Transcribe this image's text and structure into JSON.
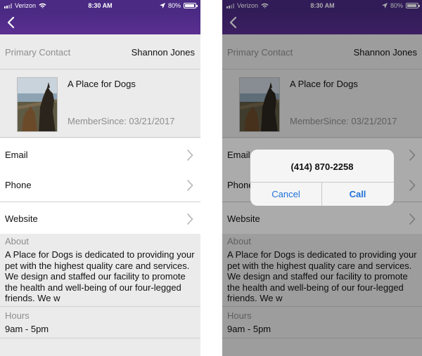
{
  "status_bar": {
    "carrier": "Verizon",
    "time": "8:30 AM",
    "battery": "80%"
  },
  "contact": {
    "label": "Primary Contact",
    "value": "Shannon Jones"
  },
  "profile": {
    "name": "A Place for Dogs",
    "member_since": "MemberSince: 03/21/2017"
  },
  "links": {
    "email": "Email",
    "phone": "Phone",
    "website": "Website"
  },
  "about": {
    "label": "About",
    "text": "A Place for Dogs is dedicated to providing your pet with the highest quality care and services. We design and staffed our facility to promote the health and well-being of our four-legged friends. We w"
  },
  "hours": {
    "label": "Hours",
    "value": "9am - 5pm"
  },
  "call_alert": {
    "number": "(414) 870-2258",
    "cancel": "Cancel",
    "call": "Call"
  },
  "colors": {
    "header": "#4a2a83",
    "link_blue": "#1f72d8"
  }
}
